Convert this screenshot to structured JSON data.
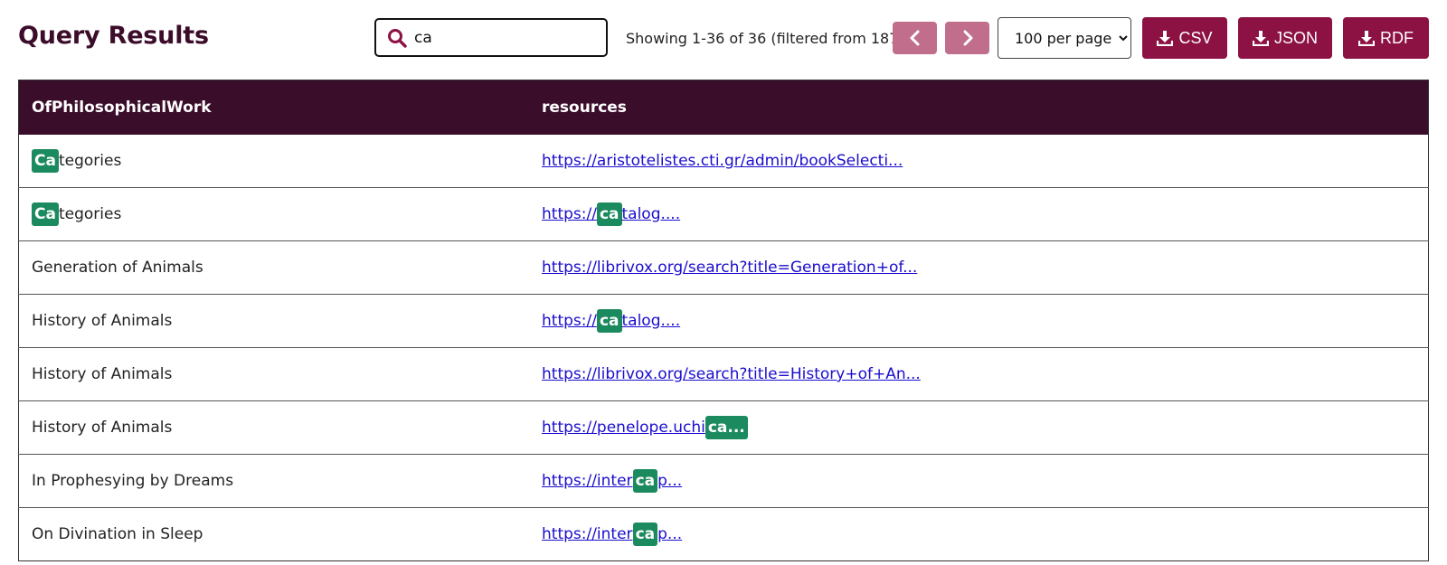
{
  "header": {
    "title": "Query Results"
  },
  "search": {
    "value": "ca",
    "icon": "search-icon"
  },
  "pagination": {
    "showing_text": "Showing 1-36 of 36 (filtered from 187)",
    "prev_icon": "chevron-left-icon",
    "next_icon": "chevron-right-icon",
    "per_page_selected": "100 per page"
  },
  "downloads": {
    "csv_label": "CSV",
    "json_label": "JSON",
    "rdf_label": "RDF",
    "icon": "download-icon"
  },
  "table": {
    "columns": [
      "OfPhilosophicalWork",
      "resources"
    ],
    "rows": [
      {
        "work": {
          "before": "",
          "match": "Ca",
          "after": "tegories"
        },
        "resource": {
          "before": "https://aristotelistes.cti.gr/admin/bookSelecti...",
          "match": "",
          "after": ""
        }
      },
      {
        "work": {
          "before": "",
          "match": "Ca",
          "after": "tegories"
        },
        "resource": {
          "before": "https://",
          "match": "ca",
          "after": "talog...."
        }
      },
      {
        "work": {
          "before": "Generation of Animals",
          "match": "",
          "after": ""
        },
        "resource": {
          "before": "https://librivox.org/search?title=Generation+of...",
          "match": "",
          "after": ""
        }
      },
      {
        "work": {
          "before": "History of Animals",
          "match": "",
          "after": ""
        },
        "resource": {
          "before": "https://",
          "match": "ca",
          "after": "talog...."
        }
      },
      {
        "work": {
          "before": "History of Animals",
          "match": "",
          "after": ""
        },
        "resource": {
          "before": "https://librivox.org/search?title=History+of+An...",
          "match": "",
          "after": ""
        }
      },
      {
        "work": {
          "before": "History of Animals",
          "match": "",
          "after": ""
        },
        "resource": {
          "before": "https://penelope.uchi",
          "match": "ca...",
          "after": ""
        }
      },
      {
        "work": {
          "before": "In Prophesying by Dreams",
          "match": "",
          "after": ""
        },
        "resource": {
          "before": "https://inter",
          "match": "ca",
          "after": "p..."
        }
      },
      {
        "work": {
          "before": "On Divination in Sleep",
          "match": "",
          "after": ""
        },
        "resource": {
          "before": "https://inter",
          "match": "ca",
          "after": "p..."
        }
      }
    ]
  },
  "colors": {
    "title": "#3c0d2a",
    "header_bg": "#3a0d2a",
    "nav_button": "#c16e8c",
    "download_button": "#8d1244",
    "highlight": "#1b8a5e",
    "link": "#1a0dcc"
  }
}
